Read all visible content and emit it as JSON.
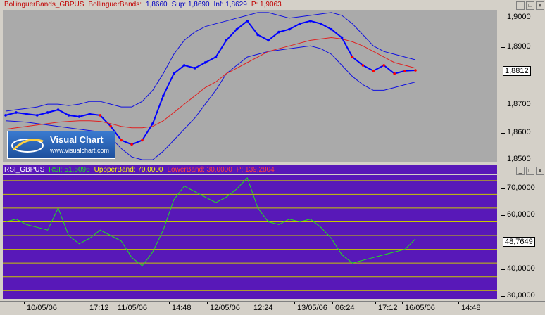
{
  "top": {
    "indicator": "BollinguerBands_GBPUS",
    "name": "BollinguerBands:",
    "value": "1,8660",
    "sup": "Sup: 1,8690",
    "inf": "Inf: 1,8629",
    "p": "P: 1,9063",
    "current": "1,8812",
    "yticks": [
      "1,9000",
      "1,8900",
      "1,8700",
      "1,8600",
      "1,8500"
    ]
  },
  "rsi": {
    "indicator": "RSI_GBPUS",
    "rsi": "RSI: 51,6096",
    "upper": "UppperBand: 70,0000",
    "lower": "LowerBand: 30,0000",
    "p": "P: 139,2804",
    "current": "48,7649",
    "yticks": [
      "70,0000",
      "60,0000",
      "40,0000",
      "30,0000"
    ]
  },
  "colors": {
    "price_up": "#0000ff",
    "price_down": "#ff0000",
    "ma": "#e02020",
    "bands": "#1010e0",
    "rsi_bg": "#5818b8",
    "rsi_line": "#20e020",
    "guides": "#c8c800"
  },
  "logo": {
    "title": "Visual Chart",
    "url": "www.visualchart.com"
  },
  "xaxis": [
    "10/05/06",
    "17:12",
    "11/05/06",
    "14:48",
    "12/05/06",
    "12:24",
    "13/05/06",
    "06:24",
    "17:12",
    "16/05/06",
    "14:48"
  ],
  "chart_data": [
    {
      "type": "line",
      "title": "BollinguerBands_GBPUS",
      "ylim": [
        1.848,
        1.903
      ],
      "series": [
        {
          "name": "BollinguerBands",
          "values": [
            1.865,
            1.866,
            1.8655,
            1.865,
            1.866,
            1.867,
            1.865,
            1.8645,
            1.8655,
            1.865,
            1.861,
            1.856,
            1.8545,
            1.856,
            1.862,
            1.872,
            1.88,
            1.883,
            1.882,
            1.884,
            1.886,
            1.892,
            1.896,
            1.899,
            1.894,
            1.892,
            1.895,
            1.896,
            1.898,
            1.899,
            1.898,
            1.896,
            1.893,
            1.886,
            1.883,
            1.881,
            1.883,
            1.88,
            1.881,
            1.8812
          ]
        },
        {
          "name": "Sup",
          "values": [
            1.8665,
            1.867,
            1.8675,
            1.868,
            1.869,
            1.869,
            1.8685,
            1.869,
            1.87,
            1.87,
            1.869,
            1.868,
            1.868,
            1.87,
            1.874,
            1.88,
            1.887,
            1.892,
            1.895,
            1.897,
            1.898,
            1.899,
            1.9,
            1.901,
            1.902,
            1.902,
            1.901,
            1.9,
            1.9005,
            1.901,
            1.9015,
            1.902,
            1.901,
            1.898,
            1.894,
            1.89,
            1.888,
            1.887,
            1.886,
            1.885
          ]
        },
        {
          "name": "Inf",
          "values": [
            1.863,
            1.8628,
            1.8625,
            1.862,
            1.8615,
            1.861,
            1.8605,
            1.86,
            1.8595,
            1.859,
            1.857,
            1.853,
            1.85,
            1.849,
            1.849,
            1.852,
            1.856,
            1.86,
            1.864,
            1.869,
            1.874,
            1.88,
            1.883,
            1.886,
            1.887,
            1.888,
            1.8885,
            1.889,
            1.8895,
            1.89,
            1.889,
            1.887,
            1.883,
            1.879,
            1.876,
            1.874,
            1.874,
            1.875,
            1.876,
            1.877
          ]
        },
        {
          "name": "P",
          "values": [
            1.86,
            1.8605,
            1.861,
            1.8615,
            1.862,
            1.8625,
            1.8628,
            1.863,
            1.863,
            1.8628,
            1.862,
            1.861,
            1.8605,
            1.8605,
            1.861,
            1.863,
            1.866,
            1.869,
            1.872,
            1.875,
            1.877,
            1.88,
            1.882,
            1.884,
            1.886,
            1.888,
            1.889,
            1.89,
            1.891,
            1.892,
            1.8925,
            1.893,
            1.8925,
            1.8915,
            1.89,
            1.888,
            1.886,
            1.884,
            1.883,
            1.882
          ]
        }
      ]
    },
    {
      "type": "line",
      "title": "RSI_GBPUS",
      "ylim": [
        27,
        72
      ],
      "series": [
        {
          "name": "RSI",
          "values": [
            55,
            56,
            54,
            53,
            52,
            60,
            50,
            47,
            49,
            52,
            50,
            48,
            42,
            39,
            44,
            52,
            63,
            68,
            66,
            64,
            62,
            64,
            67,
            71,
            60,
            55,
            54,
            56,
            55,
            56,
            53,
            49,
            43,
            40,
            41,
            42,
            43,
            44,
            45,
            48.76
          ]
        },
        {
          "name": "UppperBand",
          "values": [
            70,
            70,
            70,
            70,
            70,
            70,
            70,
            70,
            70,
            70,
            70,
            70,
            70,
            70,
            70,
            70,
            70,
            70,
            70,
            70,
            70,
            70,
            70,
            70,
            70,
            70,
            70,
            70,
            70,
            70,
            70,
            70,
            70,
            70,
            70,
            70,
            70,
            70,
            70,
            70
          ]
        },
        {
          "name": "LowerBand",
          "values": [
            30,
            30,
            30,
            30,
            30,
            30,
            30,
            30,
            30,
            30,
            30,
            30,
            30,
            30,
            30,
            30,
            30,
            30,
            30,
            30,
            30,
            30,
            30,
            30,
            30,
            30,
            30,
            30,
            30,
            30,
            30,
            30,
            30,
            30,
            30,
            30,
            30,
            30,
            30,
            30
          ]
        }
      ],
      "guides": [
        70,
        65,
        60,
        55,
        50,
        45,
        40,
        35,
        30
      ]
    }
  ]
}
